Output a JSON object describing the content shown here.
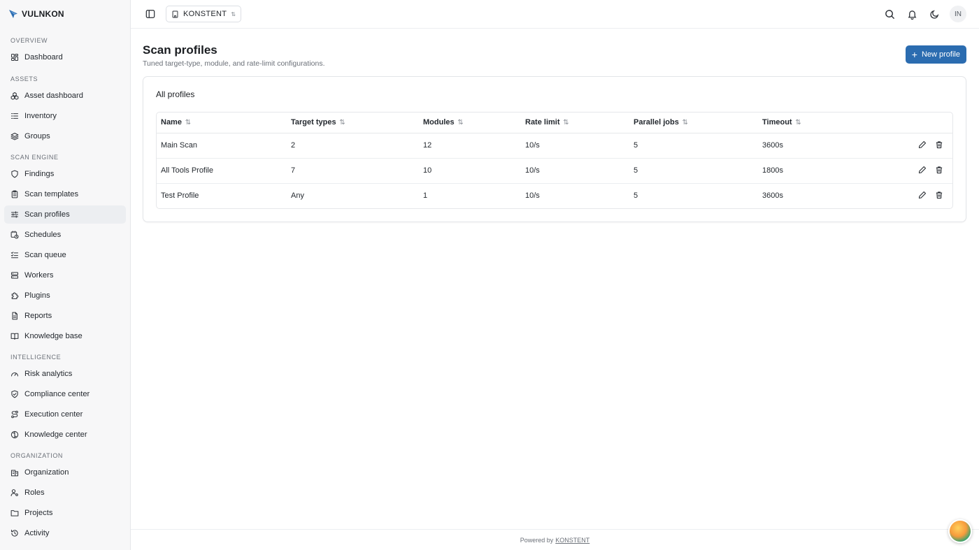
{
  "brand": {
    "name": "VULNKON"
  },
  "sidebar": {
    "sections": [
      {
        "title": "OVERVIEW",
        "items": [
          {
            "label": "Dashboard",
            "icon": "dashboard-icon"
          }
        ]
      },
      {
        "title": "ASSETS",
        "items": [
          {
            "label": "Asset dashboard",
            "icon": "boxes-icon"
          },
          {
            "label": "Inventory",
            "icon": "list-icon"
          },
          {
            "label": "Groups",
            "icon": "layers-icon"
          }
        ]
      },
      {
        "title": "SCAN ENGINE",
        "items": [
          {
            "label": "Findings",
            "icon": "shield-icon"
          },
          {
            "label": "Scan templates",
            "icon": "clipboard-icon"
          },
          {
            "label": "Scan profiles",
            "icon": "sliders-icon",
            "active": true
          },
          {
            "label": "Schedules",
            "icon": "calendar-clock-icon"
          },
          {
            "label": "Scan queue",
            "icon": "list-checks-icon"
          },
          {
            "label": "Workers",
            "icon": "server-icon"
          },
          {
            "label": "Plugins",
            "icon": "puzzle-icon"
          },
          {
            "label": "Reports",
            "icon": "file-text-icon"
          },
          {
            "label": "Knowledge base",
            "icon": "book-icon"
          }
        ]
      },
      {
        "title": "INTELLIGENCE",
        "items": [
          {
            "label": "Risk analytics",
            "icon": "gauge-icon"
          },
          {
            "label": "Compliance center",
            "icon": "shield-check-icon"
          },
          {
            "label": "Execution center",
            "icon": "route-icon"
          },
          {
            "label": "Knowledge center",
            "icon": "brain-icon"
          }
        ]
      },
      {
        "title": "ORGANIZATION",
        "items": [
          {
            "label": "Organization",
            "icon": "building-icon"
          },
          {
            "label": "Roles",
            "icon": "user-cog-icon"
          },
          {
            "label": "Projects",
            "icon": "folder-icon"
          },
          {
            "label": "Activity",
            "icon": "history-icon"
          }
        ]
      }
    ]
  },
  "topbar": {
    "org_name": "KONSTENT",
    "avatar_initials": "IN"
  },
  "page": {
    "title": "Scan profiles",
    "subtitle": "Tuned target-type, module, and rate-limit configurations.",
    "new_button": "New profile"
  },
  "card": {
    "title": "All profiles",
    "columns": [
      "Name",
      "Target types",
      "Modules",
      "Rate limit",
      "Parallel jobs",
      "Timeout"
    ],
    "rows": [
      {
        "name": "Main Scan",
        "target_types": "2",
        "modules": "12",
        "rate_limit": "10/s",
        "parallel_jobs": "5",
        "timeout": "3600s"
      },
      {
        "name": "All Tools Profile",
        "target_types": "7",
        "modules": "10",
        "rate_limit": "10/s",
        "parallel_jobs": "5",
        "timeout": "1800s"
      },
      {
        "name": "Test Profile",
        "target_types": "Any",
        "modules": "1",
        "rate_limit": "10/s",
        "parallel_jobs": "5",
        "timeout": "3600s"
      }
    ]
  },
  "footer": {
    "prefix": "Powered by",
    "link": "KONSTENT"
  },
  "colors": {
    "accent": "#2b6cb0",
    "active_nav_bg": "#eceef1"
  }
}
